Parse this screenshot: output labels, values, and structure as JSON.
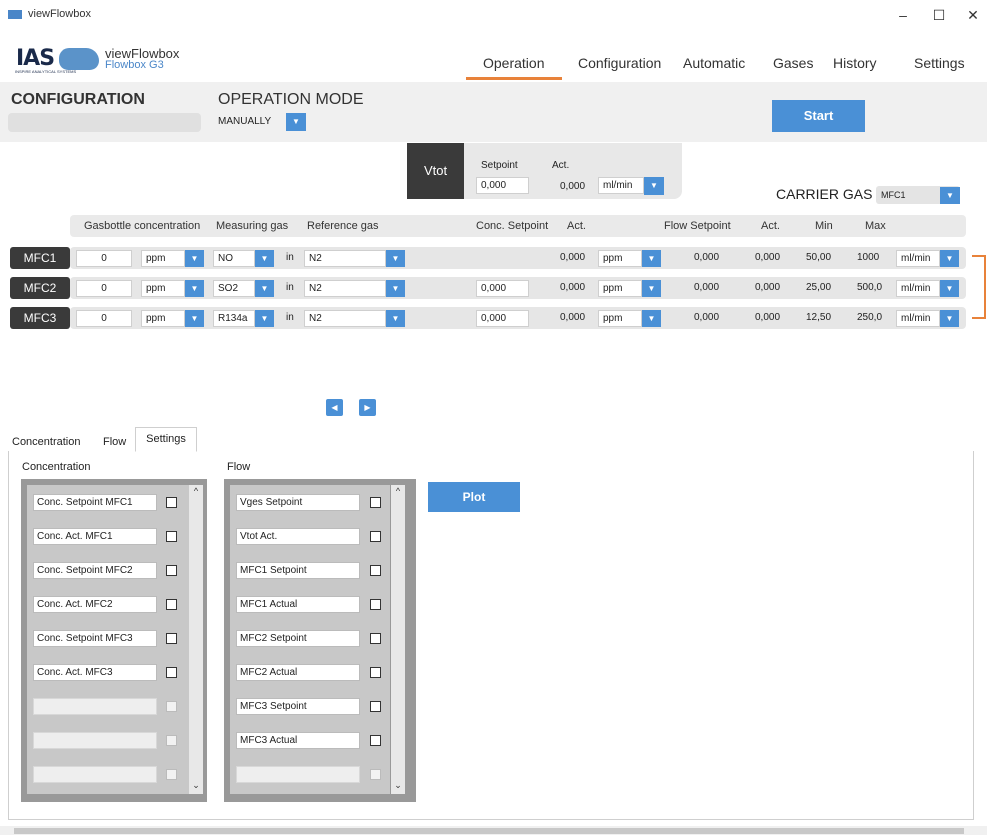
{
  "window": {
    "title": "viewFlowbox",
    "minimize": "–",
    "maximize": "☐",
    "close": "✕"
  },
  "header": {
    "logo_text": "IAS",
    "logo_tag": "INSPIRE ANALYTICAL SYSTEMS",
    "app_name": "viewFlowbox",
    "app_sub": "Flowbox G3",
    "nav": [
      "Operation",
      "Configuration",
      "Automatic",
      "Gases",
      "History",
      "Settings"
    ],
    "active_nav": "Operation"
  },
  "config": {
    "title": "CONFIGURATION",
    "value": ""
  },
  "operation_mode": {
    "title": "OPERATION MODE",
    "value": "MANUALLY"
  },
  "start_label": "Start",
  "vtot": {
    "label": "Vtot",
    "setpoint_label": "Setpoint",
    "act_label": "Act.",
    "setpoint": "0,000",
    "act": "0,000",
    "unit": "ml/min"
  },
  "carrier_gas": {
    "label": "CARRIER GAS",
    "value": "MFC1"
  },
  "columns": {
    "gasbottle": "Gasbottle concentration",
    "measuring": "Measuring gas",
    "reference": "Reference gas",
    "conc_setpoint": "Conc. Setpoint",
    "act": "Act.",
    "flow_setpoint": "Flow Setpoint",
    "act2": "Act.",
    "min": "Min",
    "max": "Max"
  },
  "mfc_rows": [
    {
      "label": "MFC1",
      "conc": "0",
      "conc_unit": "ppm",
      "gas": "NO",
      "in": "in",
      "ref": "N2",
      "conc_setpoint": "",
      "conc_act": "0,000",
      "act_unit": "ppm",
      "flow_setpoint": "0,000",
      "flow_act": "0,000",
      "min": "50,00",
      "max": "1000",
      "flow_unit": "ml/min"
    },
    {
      "label": "MFC2",
      "conc": "0",
      "conc_unit": "ppm",
      "gas": "SO2",
      "in": "in",
      "ref": "N2",
      "conc_setpoint": "0,000",
      "conc_act": "0,000",
      "act_unit": "ppm",
      "flow_setpoint": "0,000",
      "flow_act": "0,000",
      "min": "25,00",
      "max": "500,0",
      "flow_unit": "ml/min"
    },
    {
      "label": "MFC3",
      "conc": "0",
      "conc_unit": "ppm",
      "gas": "R134a",
      "in": "in",
      "ref": "N2",
      "conc_setpoint": "0,000",
      "conc_act": "0,000",
      "act_unit": "ppm",
      "flow_setpoint": "0,000",
      "flow_act": "0,000",
      "min": "12,50",
      "max": "250,0",
      "flow_unit": "ml/min"
    }
  ],
  "bottom_tabs": [
    "Concentration",
    "Flow",
    "Settings"
  ],
  "active_bottom_tab": "Settings",
  "settings": {
    "conc_title": "Concentration",
    "flow_title": "Flow",
    "conc_items": [
      "Conc. Setpoint MFC1",
      "Conc. Act. MFC1",
      "Conc. Setpoint MFC2",
      "Conc. Act. MFC2",
      "Conc. Setpoint MFC3",
      "Conc. Act. MFC3",
      "",
      "",
      ""
    ],
    "flow_items": [
      "Vges Setpoint",
      "Vtot Act.",
      "MFC1 Setpoint",
      "MFC1 Actual",
      "MFC2 Setpoint",
      "MFC2 Actual",
      "MFC3 Setpoint",
      "MFC3 Actual",
      ""
    ],
    "plot_label": "Plot"
  },
  "icons": {
    "dropdown": "caret-down-icon",
    "prev": "caret-left-icon",
    "next": "caret-right-icon",
    "scroll_up": "chevron-up-icon",
    "scroll_down": "chevron-down-icon"
  },
  "colors": {
    "accent": "#4a90d6",
    "highlight": "#e8823a",
    "dark_label": "#3a3a3a"
  }
}
